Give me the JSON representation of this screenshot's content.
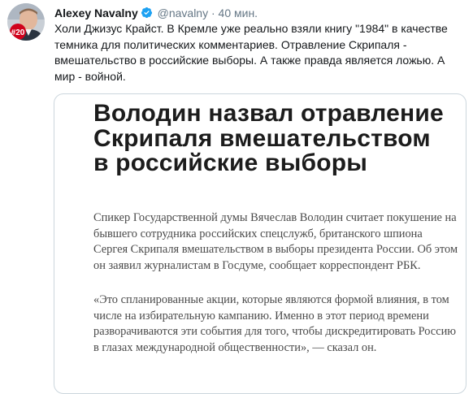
{
  "tweet": {
    "author_name": "Alexey Navalny",
    "handle": "@navalny",
    "separator": "·",
    "time": "40 мин.",
    "avatar_badge": "#20",
    "verified_icon": "verified-badge-icon",
    "text": "Холи Джизус Крайст. В Кремле уже реально взяли книгу \"1984\" в качестве темника для политических комментариев. Отравление Скрипаля - вмешательство в российские выборы. А также правда является ложью. А мир - войной."
  },
  "card": {
    "title": "Володин назвал отравление Скрипаля вмешательством в российские выборы",
    "paragraphs": [
      "Спикер Государственной думы Вячеслав Володин считает покушение на бывшего сотрудника российских спецслужб, британского шпиона Сергея Скрипаля вмешательством в выборы президента России. Об этом он заявил журналистам в Госдуме, сообщает корреспондент РБК.",
      "«Это спланированные акции, которые являются формой влияния, в том числе на избирательную кампанию. Именно в этот период времени разворачиваются эти события для того, чтобы дискредитировать Россию в глазах международной общественности», — сказал он."
    ]
  },
  "colors": {
    "verified_blue": "#1da1f2",
    "badge_red": "#d0021b",
    "muted_text": "#657786",
    "card_border": "#ccd6dd"
  }
}
